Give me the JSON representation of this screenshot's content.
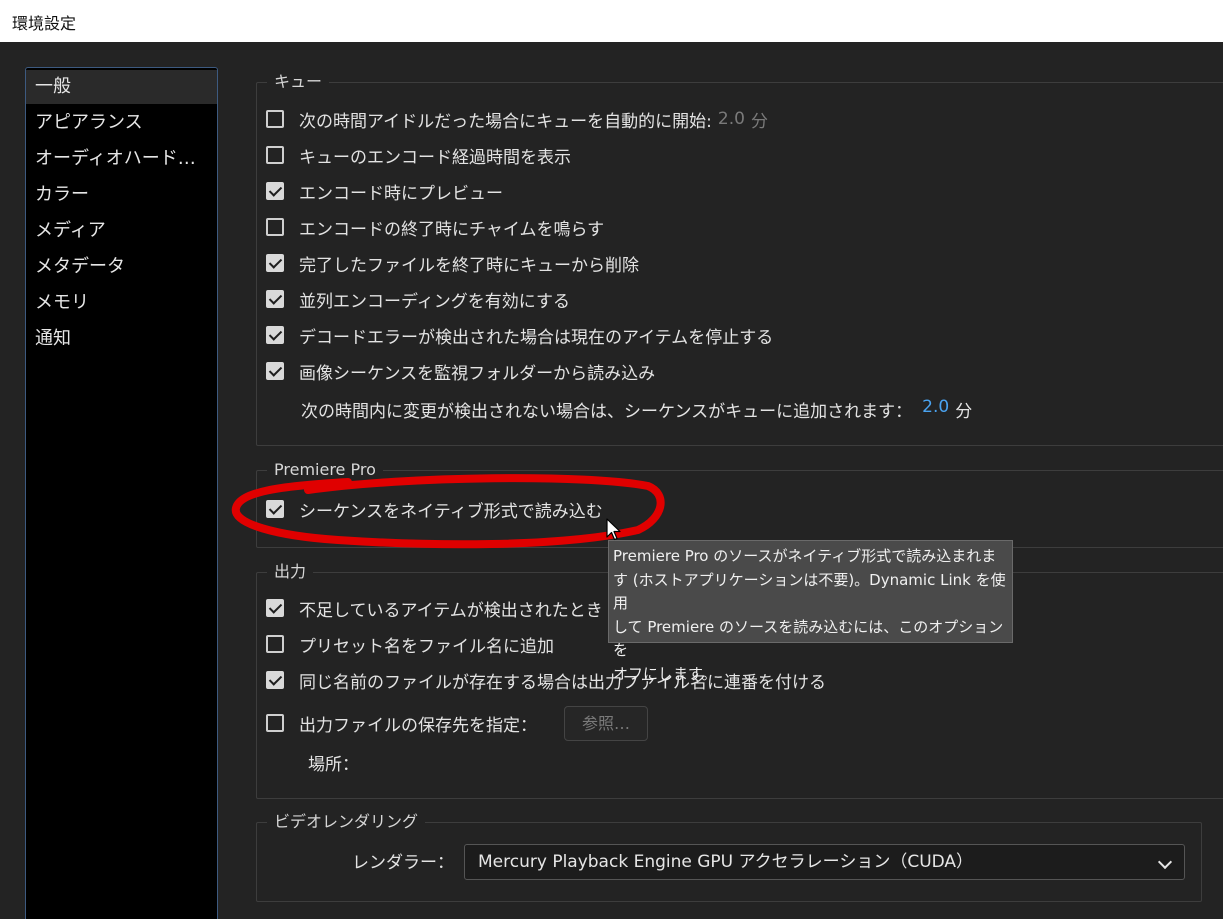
{
  "window": {
    "title": "環境設定"
  },
  "sidebar": {
    "items": [
      {
        "label": "一般",
        "active": true
      },
      {
        "label": "アピアランス"
      },
      {
        "label": "オーディオハード…"
      },
      {
        "label": "カラー"
      },
      {
        "label": "メディア"
      },
      {
        "label": "メタデータ"
      },
      {
        "label": "メモリ"
      },
      {
        "label": "通知"
      }
    ]
  },
  "queue": {
    "legend": "キュー",
    "options": [
      {
        "label": "次の時間アイドルだった場合にキューを自動的に開始:",
        "checked": false,
        "value": "2.0",
        "unit": "分"
      },
      {
        "label": "キューのエンコード経過時間を表示",
        "checked": false
      },
      {
        "label": "エンコード時にプレビュー",
        "checked": true
      },
      {
        "label": "エンコードの終了時にチャイムを鳴らす",
        "checked": false
      },
      {
        "label": "完了したファイルを終了時にキューから削除",
        "checked": true
      },
      {
        "label": "並列エンコーディングを有効にする",
        "checked": true
      },
      {
        "label": "デコードエラーが検出された場合は現在のアイテムを停止する",
        "checked": true
      },
      {
        "label": "画像シーケンスを監視フォルダーから読み込み",
        "checked": true
      }
    ],
    "sequence_note": {
      "text": "次の時間内に変更が検出されない場合は、シーケンスがキューに追加されます：",
      "value": "2.0",
      "unit": "分"
    }
  },
  "premiere": {
    "legend": "Premiere Pro",
    "options": [
      {
        "label": "シーケンスをネイティブ形式で読み込む",
        "checked": true
      }
    ]
  },
  "tooltip": {
    "lines": [
      "Premiere Pro のソースがネイティブ形式で読み込まれま",
      "す (ホストアプリケーションは不要)。Dynamic Link を使用",
      "して Premiere のソースを読み込むには、このオプションを",
      "オフにします。"
    ]
  },
  "output": {
    "legend": "出力",
    "options": [
      {
        "label": "不足しているアイテムが検出されたとき",
        "checked": true
      },
      {
        "label": "プリセット名をファイル名に追加",
        "checked": false
      },
      {
        "label": "同じ名前のファイルが存在する場合は出力ファイル名に連番を付ける",
        "checked": true
      },
      {
        "label": "出力ファイルの保存先を指定：",
        "checked": false
      }
    ],
    "browse_label": "参照…",
    "location_label": "場所："
  },
  "rendering": {
    "legend": "ビデオレンダリング",
    "renderer_label": "レンダラー：",
    "renderer_value": "Mercury Playback Engine GPU アクセラレーション（CUDA）"
  },
  "annotation": {
    "color": "#e00000"
  }
}
